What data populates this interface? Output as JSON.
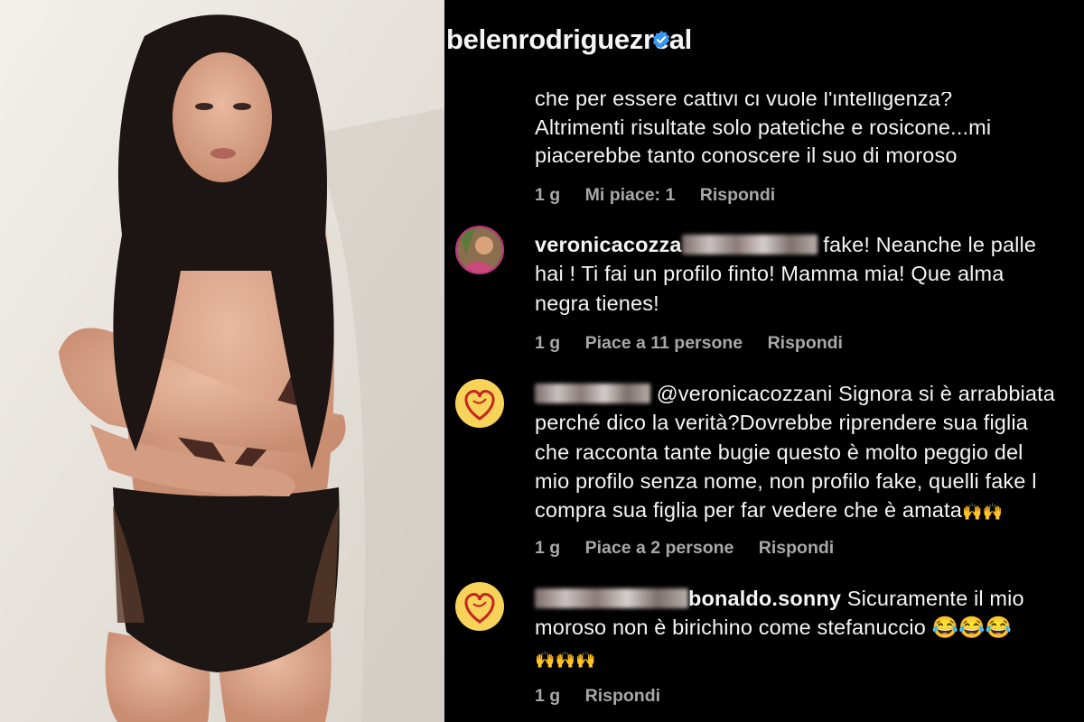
{
  "header": {
    "username": "belenrodriguezreal",
    "verified_icon": "verified-badge-icon"
  },
  "comments": [
    {
      "lines": [
        "che per essere cattivi ci vuole l'intelligenza?",
        "Altrimenti risultate solo patetiche e rosicone...mi",
        "piacerebbe tanto conoscere il suo di moroso"
      ],
      "time": "1 g",
      "likes": "Mi piace: 1",
      "reply": "Rispondi"
    },
    {
      "username_visible": "veronicacozza",
      "line1_rest": "fake! Neanche le palle",
      "lines": [
        "hai ! Ti fai un profilo finto! Mamma mia! Que alma",
        "negra tienes!"
      ],
      "time": "1 g",
      "likes": "Piace a 11 persone",
      "reply": "Rispondi"
    },
    {
      "mention": "@veronicacozzani Signora si è arrabbiata",
      "lines": [
        "perché dico la verità?Dovrebbe riprendere sua figlia",
        "che racconta tante bugie questo è molto peggio del",
        "mio profilo senza nome, non profilo fake, quelli fake l",
        "compra sua figlia per far vedere che è amata"
      ],
      "emoji": "🙌🙌",
      "time": "1 g",
      "likes": "Piace a 2 persone",
      "reply": "Rispondi"
    },
    {
      "username_visible": "bonaldo.sonny",
      "line1_rest": "Sicuramente il mio",
      "line2": "moroso non è birichino come stefanuccio",
      "emoji_laugh": "😂😂😂",
      "emoji_clap": "🙌🙌🙌",
      "time": "1 g",
      "reply": "Rispondi"
    }
  ]
}
